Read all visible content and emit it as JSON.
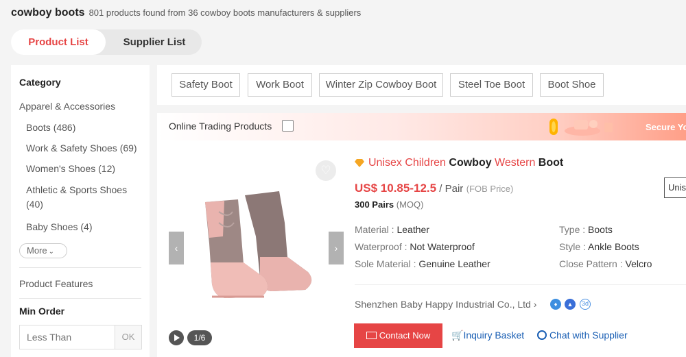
{
  "header": {
    "keyword": "cowboy boots",
    "result_count": "801 products found from 36  cowboy boots manufacturers & suppliers"
  },
  "tabs": {
    "product_list": "Product List",
    "supplier_list": "Supplier List"
  },
  "sidebar": {
    "category_title": "Category",
    "category_parent": "Apparel & Accessories",
    "items": [
      {
        "label": "Boots (486)"
      },
      {
        "label": "Work & Safety Shoes (69)"
      },
      {
        "label": "Women's Shoes (12)"
      },
      {
        "label": "Athletic & Sports Shoes (40)"
      },
      {
        "label": "Baby Shoes (4)"
      }
    ],
    "more_label": "More",
    "product_features_title": "Product Features",
    "min_order_title": "Min Order",
    "min_order_placeholder": "Less Than",
    "ok_label": "OK"
  },
  "filters": {
    "chips": [
      "Safety Boot",
      "Work Boot",
      "Winter Zip Cowboy Boot",
      "Steel Toe Boot",
      "Boot Shoe"
    ]
  },
  "trade_bar": {
    "label": "Online Trading Products",
    "secure_text": "Secure Yo"
  },
  "product": {
    "title_part1": "Unisex Children ",
    "title_part2": "Cowboy",
    "title_part3": " Western ",
    "title_part4": "Boot",
    "price": "US$ 10.85-12.5",
    "unit": " / Pair",
    "price_term": "(FOB Price)",
    "moq": "300 Pairs",
    "moq_label": "(MOQ)",
    "side_tag": "Unis",
    "image_page": "1/6",
    "attributes": [
      {
        "key": "Material : ",
        "value": "Leather"
      },
      {
        "key": "Type : ",
        "value": "Boots"
      },
      {
        "key": "Waterproof : ",
        "value": "Not Waterproof"
      },
      {
        "key": "Style : ",
        "value": "Ankle Boots"
      },
      {
        "key": "Sole Material : ",
        "value": "Genuine Leather"
      },
      {
        "key": "Close Pattern : ",
        "value": "Velcro"
      }
    ],
    "supplier": "Shenzhen Baby Happy Industrial Co., Ltd",
    "badge_text": "3d",
    "contact_label": "Contact Now",
    "inquiry_label": "Inquiry Basket",
    "chat_label": "Chat with Supplier"
  },
  "colors": {
    "brand_red": "#e64545",
    "link_blue": "#1a5fb4"
  }
}
